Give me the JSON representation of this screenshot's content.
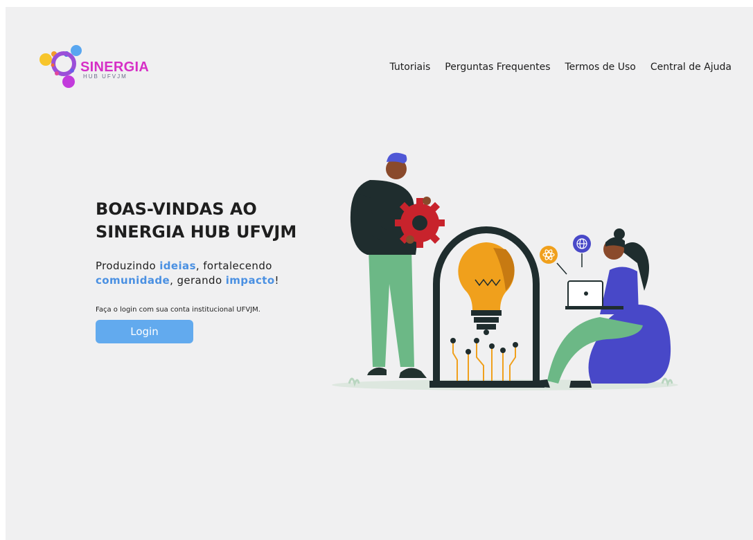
{
  "brand": {
    "name": "SINERGIA",
    "subtitle": "HUB UFVJM"
  },
  "nav": {
    "items": [
      {
        "label": "Tutoriais"
      },
      {
        "label": "Perguntas Frequentes"
      },
      {
        "label": "Termos de Uso"
      },
      {
        "label": "Central de Ajuda"
      }
    ]
  },
  "hero": {
    "title_line1": "BOAS-VINDAS AO",
    "title_line2": "SINERGIA HUB UFVJM",
    "subtitle": {
      "t1": "Produzindo ",
      "h1": "ideias",
      "t2": ", fortalecendo ",
      "h2": "comunidade",
      "t3": ", gerando ",
      "h3": "impacto",
      "t4": "!"
    },
    "login_hint": "Faça o login com sua conta institucional UFVJM.",
    "login_label": "Login"
  },
  "colors": {
    "accent": "#4a90e2",
    "button": "#62aaee",
    "brand": "#d62fc6",
    "background": "#f0f0f1"
  },
  "icons": [
    "gear-icon",
    "lightbulb-icon",
    "atom-icon",
    "globe-icon",
    "laptop-icon"
  ]
}
